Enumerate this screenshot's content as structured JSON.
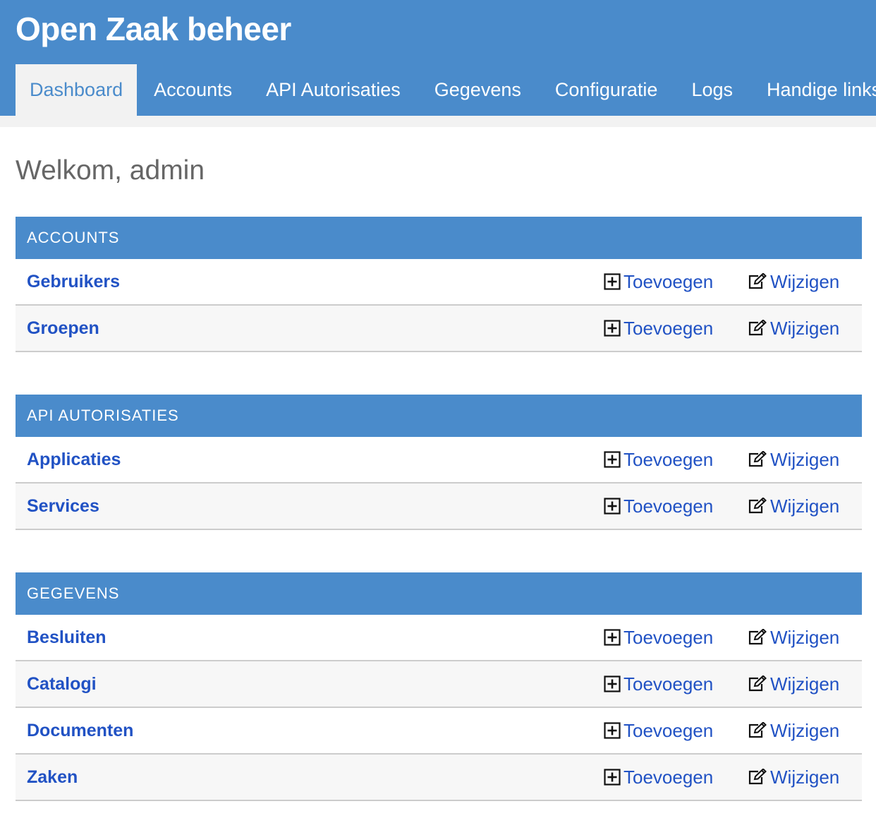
{
  "header": {
    "title": "Open Zaak beheer"
  },
  "nav": {
    "tabs": [
      {
        "label": "Dashboard",
        "active": true
      },
      {
        "label": "Accounts",
        "active": false
      },
      {
        "label": "API Autorisaties",
        "active": false
      },
      {
        "label": "Gegevens",
        "active": false
      },
      {
        "label": "Configuratie",
        "active": false
      },
      {
        "label": "Logs",
        "active": false
      },
      {
        "label": "Handige links",
        "active": false
      }
    ]
  },
  "welcome": "Welkom, admin",
  "actions": {
    "add_label": "Toevoegen",
    "add_icon": "plus-square-icon",
    "change_label": "Wijzigen",
    "change_icon": "edit-icon"
  },
  "modules": [
    {
      "title": "ACCOUNTS",
      "models": [
        {
          "name": "Gebruikers"
        },
        {
          "name": "Groepen"
        }
      ]
    },
    {
      "title": "API AUTORISATIES",
      "models": [
        {
          "name": "Applicaties"
        },
        {
          "name": "Services"
        }
      ]
    },
    {
      "title": "GEGEVENS",
      "models": [
        {
          "name": "Besluiten"
        },
        {
          "name": "Catalogi"
        },
        {
          "name": "Documenten"
        },
        {
          "name": "Zaken"
        }
      ]
    }
  ],
  "colors": {
    "header_bg": "#4a8bcb",
    "link": "#2152c4",
    "active_tab_bg": "#f2f2f2",
    "row_alt_bg": "#f7f7f7"
  }
}
